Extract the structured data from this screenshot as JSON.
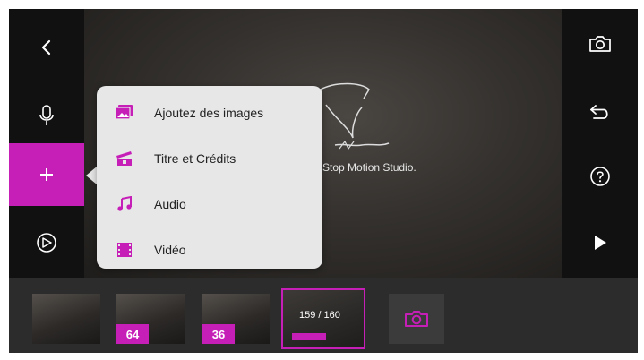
{
  "colors": {
    "accent": "#c61fb8",
    "sidebar": "#111111",
    "filmstrip": "#2c2c2c",
    "menu": "#e7e7e7"
  },
  "left_sidebar": {
    "buttons": [
      {
        "icon": "back-chevron-icon"
      },
      {
        "icon": "microphone-icon"
      },
      {
        "icon": "plus-icon"
      },
      {
        "icon": "settings-wheel-icon"
      }
    ]
  },
  "right_sidebar": {
    "buttons": [
      {
        "icon": "camera-icon"
      },
      {
        "icon": "undo-icon"
      },
      {
        "icon": "help-icon"
      },
      {
        "icon": "play-icon"
      }
    ]
  },
  "preview": {
    "title": "Stop Motion Studio."
  },
  "add_menu": {
    "items": [
      {
        "label": "Ajoutez des images",
        "icon": "images-icon"
      },
      {
        "label": "Titre et Crédits",
        "icon": "title-clapper-icon"
      },
      {
        "label": "Audio",
        "icon": "music-note-icon"
      },
      {
        "label": "Vidéo",
        "icon": "film-icon"
      }
    ]
  },
  "filmstrip": {
    "thumbs": [
      {
        "badge": ""
      },
      {
        "badge": "64"
      },
      {
        "badge": "36"
      }
    ],
    "selected": {
      "counter": "159 / 160"
    },
    "capture_icon": "camera-icon"
  }
}
